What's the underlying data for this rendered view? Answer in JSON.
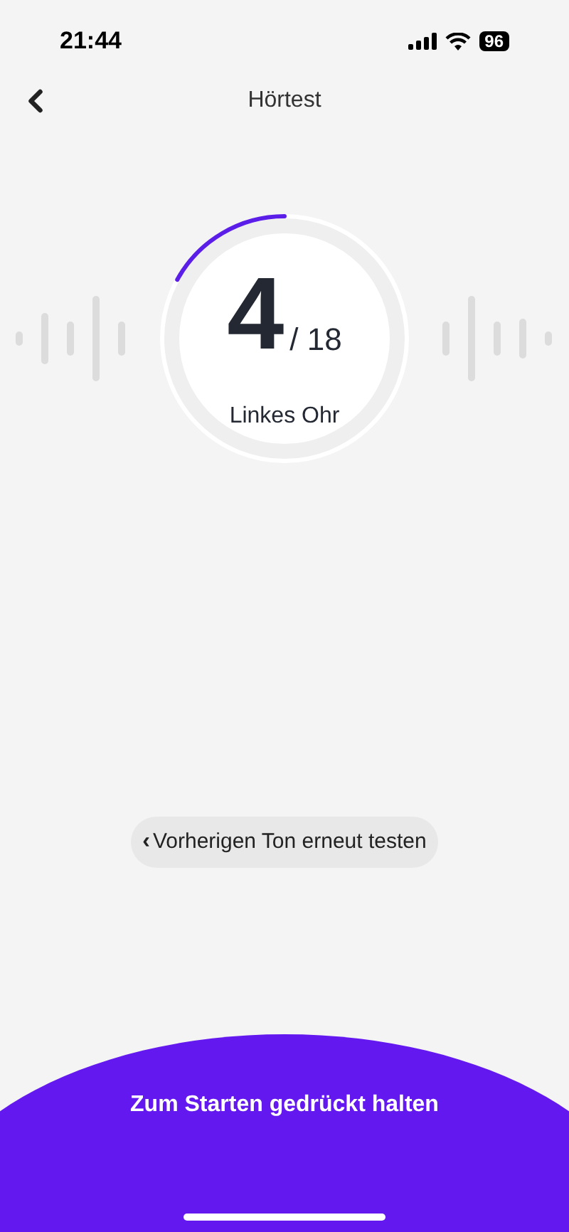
{
  "status_bar": {
    "time": "21:44",
    "battery": "96"
  },
  "header": {
    "title": "Hörtest"
  },
  "progress": {
    "current": "4",
    "total": "/ 18",
    "level": 0.17,
    "label": "Linkes Ohr"
  },
  "retry_button": {
    "icon": "‹",
    "label": "Vorherigen Ton erneut testen"
  },
  "start_area": {
    "label": "Zum Starten gedrückt halten"
  }
}
